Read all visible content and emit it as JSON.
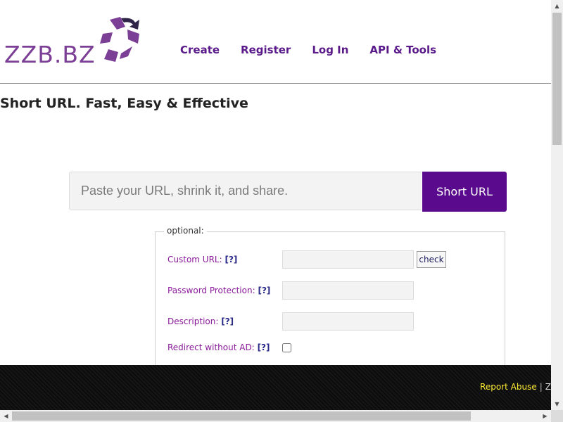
{
  "header": {
    "logo_text": "ZZB.BZ",
    "nav": [
      {
        "label": "Create"
      },
      {
        "label": "Register"
      },
      {
        "label": "Log In"
      },
      {
        "label": "API & Tools"
      }
    ]
  },
  "tagline": "Short URL. Fast, Easy & Effective",
  "shortener": {
    "placeholder": "Paste your URL, shrink it, and share.",
    "button_label": "Short URL"
  },
  "optional": {
    "legend": "optional:",
    "help_label": "[?]",
    "custom_url_label": "Custom URL:",
    "check_label": "check",
    "password_label": "Password Protection:",
    "description_label": "Description:",
    "redirect_label": "Redirect without AD:"
  },
  "footer": {
    "report_abuse": "Report Abuse",
    "separator": "|",
    "truncated": "Z"
  },
  "colors": {
    "brand_purple": "#5a0a8c",
    "label_purple": "#8a1a9a",
    "footer_link": "#ffee33"
  }
}
